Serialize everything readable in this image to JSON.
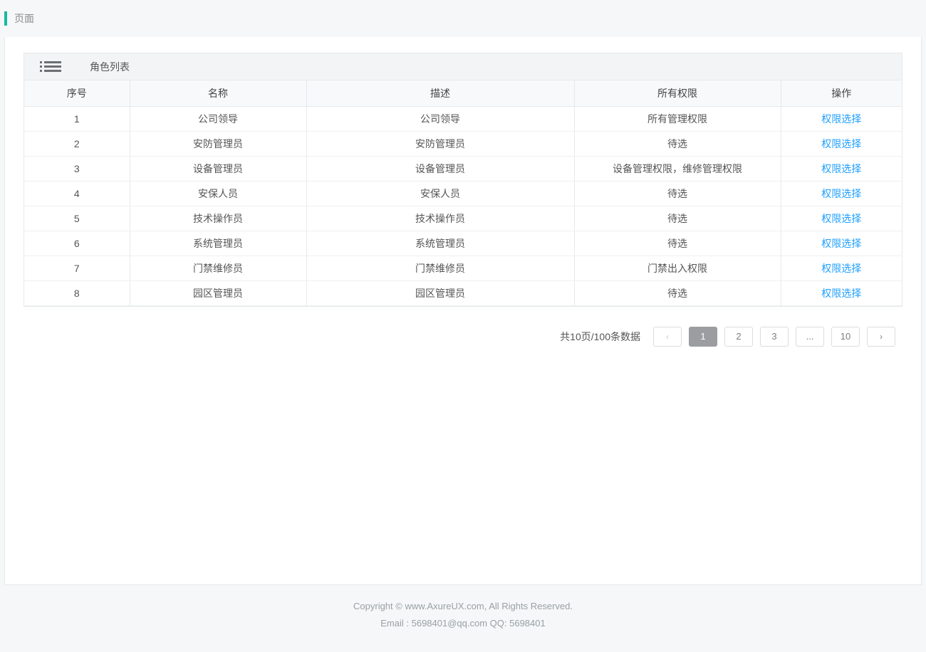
{
  "header": {
    "title": "页面"
  },
  "panel": {
    "title": "角色列表"
  },
  "table": {
    "columns": {
      "seq": "序号",
      "name": "名称",
      "desc": "描述",
      "perm": "所有权限",
      "act": "操作"
    },
    "action_label": "权限选择",
    "rows": [
      {
        "seq": "1",
        "name": "公司领导",
        "desc": "公司领导",
        "perm": "所有管理权限"
      },
      {
        "seq": "2",
        "name": "安防管理员",
        "desc": "安防管理员",
        "perm": "待选"
      },
      {
        "seq": "3",
        "name": "设备管理员",
        "desc": "设备管理员",
        "perm": "设备管理权限，维修管理权限"
      },
      {
        "seq": "4",
        "name": "安保人员",
        "desc": "安保人员",
        "perm": "待选"
      },
      {
        "seq": "5",
        "name": "技术操作员",
        "desc": "技术操作员",
        "perm": "待选"
      },
      {
        "seq": "6",
        "name": "系统管理员",
        "desc": "系统管理员",
        "perm": "待选"
      },
      {
        "seq": "7",
        "name": "门禁维修员",
        "desc": "门禁维修员",
        "perm": "门禁出入权限"
      },
      {
        "seq": "8",
        "name": "园区管理员",
        "desc": "园区管理员",
        "perm": "待选"
      }
    ]
  },
  "pagination": {
    "summary": "共10页/100条数据",
    "pages": [
      "1",
      "2",
      "3",
      "...",
      "10"
    ],
    "active": "1"
  },
  "footer": {
    "line1": "Copyright © www.AxureUX.com, All Rights Reserved.",
    "line2": "Email : 5698401@qq.com  QQ: 5698401"
  }
}
